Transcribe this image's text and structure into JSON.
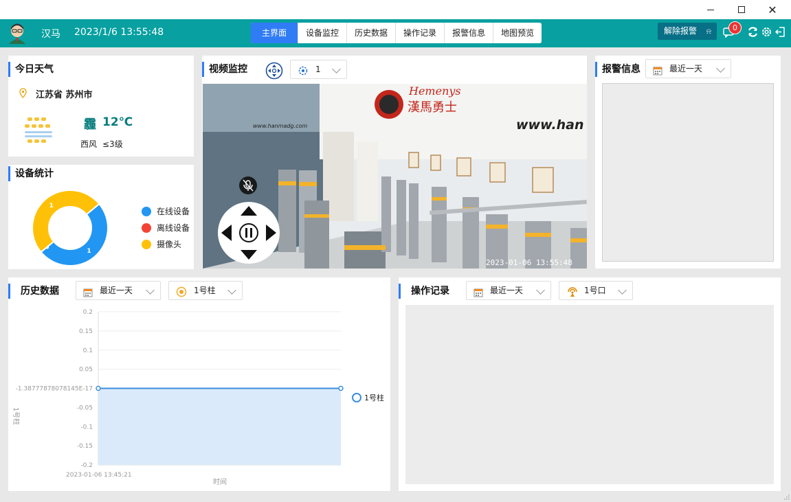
{
  "header": {
    "user": "汉马",
    "datetime": "2023/1/6 13:55:48",
    "tabs": [
      {
        "label": "主界面",
        "active": true
      },
      {
        "label": "设备监控",
        "active": false
      },
      {
        "label": "历史数据",
        "active": false
      },
      {
        "label": "操作记录",
        "active": false
      },
      {
        "label": "报警信息",
        "active": false
      },
      {
        "label": "地图预览",
        "active": false
      }
    ],
    "clear_alarm": "解除报警",
    "notif_count": "0",
    "accent": "#08a0a0"
  },
  "weather": {
    "title": "今日天气",
    "location": "江苏省 苏州市",
    "condition_icon": "haze-icon",
    "temp": "12℃",
    "wind": "西风",
    "level": "≤3级"
  },
  "devices": {
    "title": "设备统计",
    "legend": [
      {
        "label": "在线设备",
        "color": "#2196f3"
      },
      {
        "label": "离线设备",
        "color": "#f44336"
      },
      {
        "label": "摄像头",
        "color": "#ffc107"
      }
    ],
    "donut": [
      {
        "label": "1",
        "value": 1,
        "color": "#2196f3"
      },
      {
        "label": "0",
        "value": 0,
        "color": "#f44336"
      },
      {
        "label": "1",
        "value": 1,
        "color": "#ffc107"
      }
    ]
  },
  "video": {
    "title": "视频监控",
    "channel": "1",
    "timestamp": "2023-01-06  13:55:48",
    "scene_text_1": "Hemenys",
    "scene_text_2": "www.hanmadg.com",
    "scene_text_3": "www.han"
  },
  "alarm": {
    "title": "报警信息",
    "range": "最近一天"
  },
  "history": {
    "title": "历史数据",
    "range": "最近一天",
    "device": "1号柱",
    "xlabel": "时间",
    "ylabel": "1号柱",
    "x_start": "2023-01-06 13:45:21",
    "series_label": "1号柱"
  },
  "oplog": {
    "title": "操作记录",
    "range": "最近一天",
    "device": "1号口"
  },
  "chart_data": {
    "type": "area",
    "xlabel": "时间",
    "ylabel": "1号柱",
    "ylim": [
      -0.2,
      0.2
    ],
    "yticks": [
      "0.2",
      "0.15",
      "0.1",
      "0.05",
      "-1.38777878078145E-17",
      "-0.05",
      "-0.1",
      "-0.15",
      "-0.2"
    ],
    "x": [
      "2023-01-06 13:45:21",
      ""
    ],
    "series": [
      {
        "name": "1号柱",
        "values": [
          0,
          0
        ],
        "color": "#3b8fdb"
      }
    ],
    "grid": true,
    "legend": "right"
  }
}
